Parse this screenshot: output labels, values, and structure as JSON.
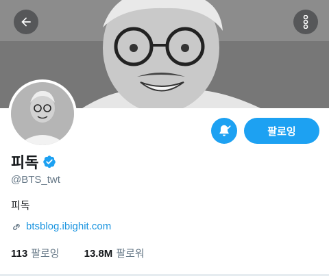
{
  "profile": {
    "display_name": "피독",
    "handle": "@BTS_twt",
    "bio": "피독",
    "link": "btsblog.ibighit.com"
  },
  "actions": {
    "follow_label": "팔로잉"
  },
  "stats": {
    "following_count": "113",
    "following_label": "팔로잉",
    "followers_count": "13.8M",
    "followers_label": "팔로워"
  },
  "icons": {
    "back": "arrow-left-icon",
    "more": "more-vertical-icon",
    "notifications": "bell-check-icon",
    "verified": "verified-badge-icon",
    "link": "link-icon"
  },
  "colors": {
    "accent": "#1da1f2",
    "link": "#1b95e0",
    "secondary_text": "#657786"
  }
}
